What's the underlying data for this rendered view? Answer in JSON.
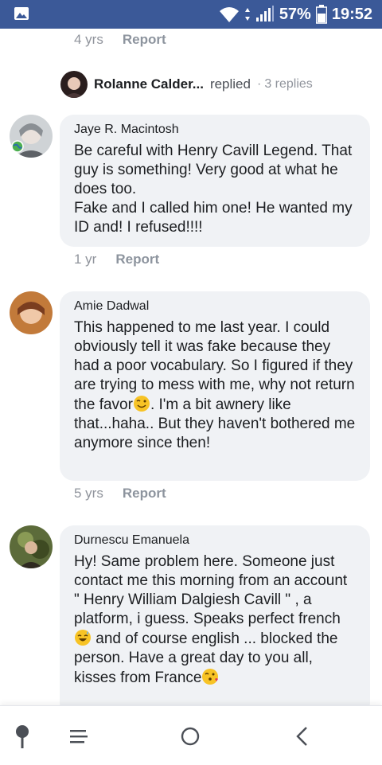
{
  "status_bar": {
    "battery": "57%",
    "time": "19:52",
    "icons": [
      "image-icon",
      "wifi-icon",
      "signal-icon",
      "battery-icon"
    ]
  },
  "prev_comment_meta": {
    "age": "4 yrs",
    "report": "Report"
  },
  "replied": {
    "name": "Rolanne Calder...",
    "verb": "replied",
    "separator": "·",
    "count": "3 replies"
  },
  "comments": [
    {
      "author": "Jaye R. Macintosh",
      "text": "Be careful with Henry Cavill Legend. That guy is something! Very good at what he does too.\nFake and I called him one! He wanted my ID and! I refused!!!!",
      "age": "1 yr",
      "report": "Report"
    },
    {
      "author": "Amie Dadwal",
      "text_before_emoji": "This happened to me last year. I could obviously tell it was fake because they had a poor vocabulary. So I figured if they are trying to mess with me, why not return the favor",
      "text_after_emoji": ". I'm a bit awnery like that...haha.. But they haven't bothered me anymore since then!",
      "emoji": "winking-face",
      "age": "5 yrs",
      "report": "Report"
    },
    {
      "author": "Durnescu Emanuela",
      "text_before_emoji": "Hy! Same problem here. Someone just contact me this morning from an account \" Henry William Dalgiesh Cavill \" , a platform, i guess. Speaks perfect french ",
      "text_middle": " and of course english ... blocked the person. Have a great day to you all, kisses from France",
      "emoji_1": "sweat-smile-face",
      "emoji_2": "kiss-face"
    }
  ],
  "nav_bar": {
    "icons": [
      "pin-icon",
      "menu-icon",
      "home-circle-icon",
      "back-icon"
    ]
  },
  "colors": {
    "status_bar": "#3b5998",
    "bubble": "#f0f2f5",
    "meta_text": "#90949c"
  }
}
